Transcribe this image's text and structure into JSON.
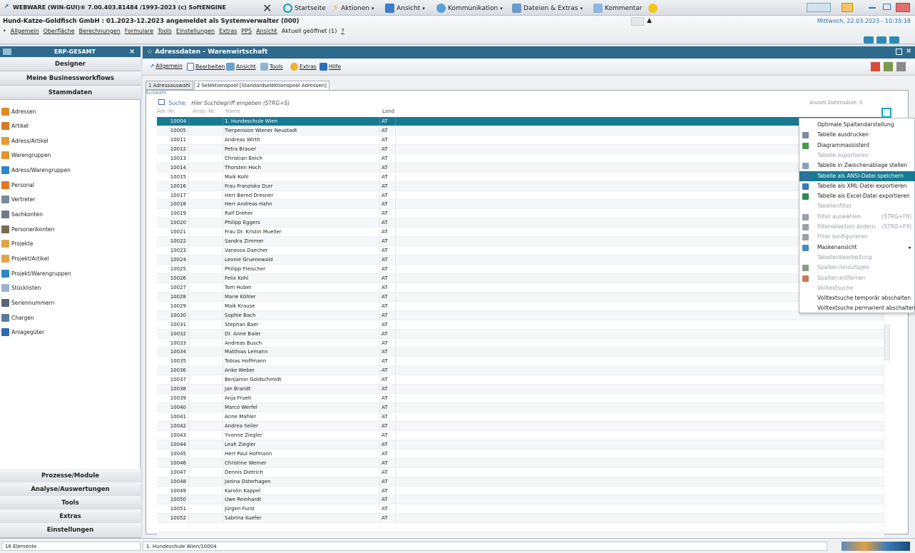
{
  "app_title": "WEBWARE (WIN-GUI)® 7.00.403.81484 /1993-2023 (c) SoftENGINE",
  "toolbar": [
    {
      "label": "Startseite",
      "icon": "home-icon"
    },
    {
      "label": "Aktionen",
      "icon": "lightning-icon"
    },
    {
      "label": "Ansicht",
      "icon": "view-icon"
    },
    {
      "label": "Kommunikation",
      "icon": "communication-icon"
    },
    {
      "label": "Dateien & Extras",
      "icon": "files-icon"
    },
    {
      "label": "Kommentar",
      "icon": "comment-icon"
    }
  ],
  "header": {
    "company_line": "Hund-Katze-Goldfisch GmbH : 01.2023-12.2023 angemeldet als Systemverwalter (000)",
    "datetime": "Mittwoch, 22.03.2023 - 10:35:18",
    "menu": [
      "Allgemein",
      "Oberfläche",
      "Berechnungen",
      "Formulare",
      "Tools",
      "Einstellungen",
      "Extras",
      "PPS",
      "Ansicht",
      "Aktuell geöffnet (1)",
      "?"
    ]
  },
  "sidebar": {
    "title": "ERP-GESAMT",
    "close": "×",
    "top_buttons": [
      "Designer",
      "Meine Businessworkflows",
      "Stammdaten"
    ],
    "items": [
      {
        "label": "Adressen",
        "color": "#e08a2a"
      },
      {
        "label": "Artikel",
        "color": "#d67a2a"
      },
      {
        "label": "Adress/Artikel",
        "color": "#e59b3a"
      },
      {
        "label": "Warengruppen",
        "color": "#e0962d"
      },
      {
        "label": "Adress/Warengruppen",
        "color": "#2e86c8"
      },
      {
        "label": "Personal",
        "color": "#e07a20"
      },
      {
        "label": "Vertreter",
        "color": "#7a8a99"
      },
      {
        "label": "Sachkonten",
        "color": "#6d7a88"
      },
      {
        "label": "Personenkonten",
        "color": "#7b6a55"
      },
      {
        "label": "Projekte",
        "color": "#e0a44a"
      },
      {
        "label": "Projekt/Artikel",
        "color": "#e0a44a"
      },
      {
        "label": "Projekt/Warengruppen",
        "color": "#2e86c8"
      },
      {
        "label": "Stücklisten",
        "color": "#9ab4d0"
      },
      {
        "label": "Seriennummern",
        "color": "#5a6675"
      },
      {
        "label": "Chargen",
        "color": "#5a7aa0"
      },
      {
        "label": "Anlagegüter",
        "color": "#2e6ab0"
      }
    ],
    "bottom_buttons": [
      "Prozesse/Module",
      "Analyse/Auswertungen",
      "Tools",
      "Extras",
      "Einstellungen"
    ]
  },
  "main": {
    "title": "☆ Adressdaten - Warenwirtschaft",
    "toolbar": [
      {
        "label": "Allgemein",
        "icon": "arrow-icon"
      },
      {
        "label": "Bearbeiten",
        "icon": "edit-icon"
      },
      {
        "label": "Ansicht",
        "icon": "view-icon"
      },
      {
        "label": "Tools",
        "icon": "tools-icon"
      },
      {
        "label": "Extras",
        "icon": "extras-icon"
      },
      {
        "label": "Hilfe",
        "icon": "help-icon"
      }
    ],
    "tabs": [
      "1 Adressauswahl",
      "2 Selektionspool [Standardselektionspool Adressen]"
    ],
    "auswahl_label": "Auswahl",
    "search": {
      "label": "Suche:",
      "placeholder": "Hier Suchbegriff eingeben (STRG+S)"
    },
    "anzahl_label": "Anzahl Datensätze: 0",
    "columns": [
      "Adr.-Nr.",
      "Ansp.-Nr.",
      "Name",
      "Land"
    ],
    "rows": [
      [
        "10004",
        "1. Hundeschule Wien",
        "AT"
      ],
      [
        "10005",
        "Tierpension Wiener Neustadt",
        "AT"
      ],
      [
        "10011",
        "Andreas Wirth",
        "AT"
      ],
      [
        "10012",
        "Petra Brauer",
        "AT"
      ],
      [
        "10013",
        "Christian Beich",
        "AT"
      ],
      [
        "10014",
        "Thorsten Hoch",
        "AT"
      ],
      [
        "10015",
        "Maik Kohl",
        "AT"
      ],
      [
        "10016",
        "Frau Franziska Durr",
        "AT"
      ],
      [
        "10017",
        "Herr Bernd Dresner",
        "AT"
      ],
      [
        "10018",
        "Herr Andreas Hahn",
        "AT"
      ],
      [
        "10019",
        "Ralf Dreher",
        "AT"
      ],
      [
        "10020",
        "Philipp Eggers",
        "AT"
      ],
      [
        "10021",
        "Frau Dr. Kristin Mueller",
        "AT"
      ],
      [
        "10022",
        "Sandra Zimmer",
        "AT"
      ],
      [
        "10023",
        "Vanessa Daecher",
        "AT"
      ],
      [
        "10024",
        "Leonie Gruenewald",
        "AT"
      ],
      [
        "10025",
        "Philipp Fleischer",
        "AT"
      ],
      [
        "10026",
        "Felix Kohl",
        "AT"
      ],
      [
        "10027",
        "Tom Huber",
        "AT"
      ],
      [
        "10028",
        "Marie Köhler",
        "AT"
      ],
      [
        "10029",
        "Maik Krause",
        "AT"
      ],
      [
        "10030",
        "Sophie Bach",
        "AT"
      ],
      [
        "10031",
        "Stephan Baer",
        "AT"
      ],
      [
        "10032",
        "Dr. Anne Baier",
        "AT"
      ],
      [
        "10033",
        "Andreas Busch",
        "AT"
      ],
      [
        "10034",
        "Matthias Lemann",
        "AT"
      ],
      [
        "10035",
        "Tobias Hoffmann",
        "AT"
      ],
      [
        "10036",
        "Anke Weber",
        "AT"
      ],
      [
        "10037",
        "Benjamin Goldschmidt",
        "AT"
      ],
      [
        "10038",
        "Jan Brandt",
        "AT"
      ],
      [
        "10039",
        "Anja Frueh",
        "AT"
      ],
      [
        "10040",
        "Marco Werfel",
        "AT"
      ],
      [
        "10041",
        "Anne Mahler",
        "AT"
      ],
      [
        "10042",
        "Andrea Seiler",
        "AT"
      ],
      [
        "10043",
        "Yvonne Ziegler",
        "AT"
      ],
      [
        "10044",
        "Leah Ziegler",
        "AT"
      ],
      [
        "10045",
        "Herr Paul Hofmann",
        "AT"
      ],
      [
        "10046",
        "Christine Werner",
        "AT"
      ],
      [
        "10047",
        "Dennis Dietrich",
        "AT"
      ],
      [
        "10048",
        "Janina Osterhagen",
        "AT"
      ],
      [
        "10049",
        "Karolin Kappel",
        "AT"
      ],
      [
        "10050",
        "Uwe Reinhardt",
        "AT"
      ],
      [
        "10051",
        "Jürgen Furst",
        "AT"
      ],
      [
        "10052",
        "Sabrina Kuefer",
        "AT"
      ]
    ]
  },
  "context_menu": [
    {
      "label": "Optimale Spaltendarstellung",
      "enabled": true,
      "icon": ""
    },
    {
      "label": "Tabelle ausdrucken",
      "enabled": true,
      "icon": "print-icon"
    },
    {
      "label": "Diagrammassistent",
      "enabled": true,
      "icon": "chart-icon"
    },
    {
      "label": "Tabelle exportieren",
      "enabled": false,
      "icon": ""
    },
    {
      "label": "Tabelle in Zwischenablage stellen",
      "enabled": true,
      "icon": "clipboard-icon"
    },
    {
      "label": "Tabelle als ANSI-Datei speichern",
      "enabled": true,
      "highlight": true,
      "icon": "save-icon"
    },
    {
      "label": "Tabelle als XML-Datei exportieren",
      "enabled": true,
      "icon": "xml-icon"
    },
    {
      "label": "Tabelle als Excel-Datei exportieren",
      "enabled": true,
      "icon": "excel-icon"
    },
    {
      "label": "Tabellenfilter",
      "enabled": false,
      "icon": ""
    },
    {
      "label": "Filter auswählen",
      "shortcut": "(STRG+F8)",
      "enabled": false,
      "icon": "filter-icon"
    },
    {
      "label": "Filterselektion ändern",
      "shortcut": "(STRG+F9)",
      "enabled": false,
      "icon": "filter-icon"
    },
    {
      "label": "Filter konfigurieren",
      "enabled": false,
      "icon": "filter-icon"
    },
    {
      "label": "Maskenansicht",
      "enabled": true,
      "submenu": "▸",
      "icon": "mask-icon"
    },
    {
      "label": "Tabellenbearbeitung",
      "enabled": false,
      "icon": ""
    },
    {
      "label": "Spalten hinzufügen",
      "enabled": false,
      "icon": "add-column-icon"
    },
    {
      "label": "Spalten entfernen",
      "enabled": false,
      "icon": "remove-column-icon"
    },
    {
      "label": "Volltextsuche",
      "enabled": false,
      "icon": ""
    },
    {
      "label": "Volltextsuche temporär abschalten",
      "enabled": true,
      "icon": ""
    },
    {
      "label": "Volltextsuche permanent abschalten",
      "enabled": true,
      "icon": ""
    }
  ],
  "status": {
    "count": "16 Elemente",
    "selection": "1. Hundeschule Wien/10004"
  },
  "colors": {
    "accent": "#2e6a8e",
    "selection": "#167a92"
  }
}
